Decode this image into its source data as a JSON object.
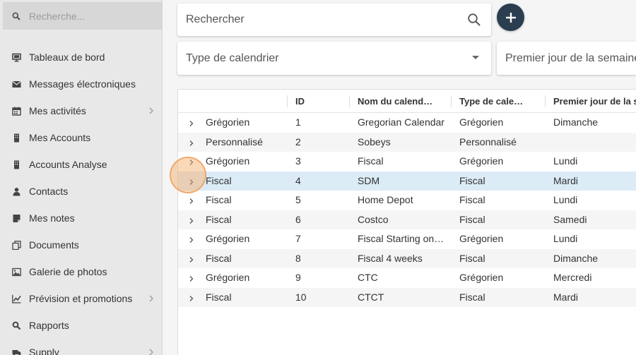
{
  "sidebar": {
    "search_placeholder": "Recherche...",
    "items": [
      {
        "label": "Tableaux de bord",
        "icon": "monitor-icon",
        "chevron": false
      },
      {
        "label": "Messages électroniques",
        "icon": "envelope-icon",
        "chevron": false
      },
      {
        "label": "Mes activités",
        "icon": "calendar-icon",
        "chevron": true
      },
      {
        "label": "Mes Accounts",
        "icon": "building-icon",
        "chevron": false
      },
      {
        "label": "Accounts Analyse",
        "icon": "building-icon",
        "chevron": false
      },
      {
        "label": "Contacts",
        "icon": "user-icon",
        "chevron": false
      },
      {
        "label": "Mes notes",
        "icon": "note-icon",
        "chevron": false
      },
      {
        "label": "Documents",
        "icon": "documents-icon",
        "chevron": false
      },
      {
        "label": "Galerie de photos",
        "icon": "image-icon",
        "chevron": false
      },
      {
        "label": "Prévision et promotions",
        "icon": "line-chart-icon",
        "chevron": true
      },
      {
        "label": "Rapports",
        "icon": "search-report-icon",
        "chevron": false
      },
      {
        "label": "Supply",
        "icon": "truck-icon",
        "chevron": true
      }
    ]
  },
  "toolbar": {
    "search_placeholder": "Rechercher",
    "add_label": "+",
    "filter_type": "Type de calendrier",
    "filter_first_day": "Premier jour de la semaine"
  },
  "grid": {
    "columns": [
      "",
      "ID",
      "Nom du calend…",
      "Type de cale…",
      "Premier jour de la se"
    ],
    "rows": [
      {
        "group": "Grégorien",
        "id": "1",
        "name": "Gregorian Calendar",
        "type": "Grégorien",
        "first_day": "Dimanche"
      },
      {
        "group": "Personnalisé",
        "id": "2",
        "name": "Sobeys",
        "type": "Personnalisé",
        "first_day": ""
      },
      {
        "group": "Grégorien",
        "id": "3",
        "name": "Fiscal",
        "type": "Grégorien",
        "first_day": "Lundi"
      },
      {
        "group": "Fiscal",
        "id": "4",
        "name": "SDM",
        "type": "Fiscal",
        "first_day": "Mardi"
      },
      {
        "group": "Fiscal",
        "id": "5",
        "name": "Home Depot",
        "type": "Fiscal",
        "first_day": "Lundi"
      },
      {
        "group": "Fiscal",
        "id": "6",
        "name": "Costco",
        "type": "Fiscal",
        "first_day": "Samedi"
      },
      {
        "group": "Grégorien",
        "id": "7",
        "name": "Fiscal Starting on …",
        "type": "Grégorien",
        "first_day": "Lundi"
      },
      {
        "group": "Fiscal",
        "id": "8",
        "name": "Fiscal 4 weeks",
        "type": "Fiscal",
        "first_day": "Dimanche"
      },
      {
        "group": "Grégorien",
        "id": "9",
        "name": "CTC",
        "type": "Grégorien",
        "first_day": "Mercredi"
      },
      {
        "group": "Fiscal",
        "id": "10",
        "name": "CTCT",
        "type": "Fiscal",
        "first_day": "Mardi"
      }
    ],
    "selected_row": 3
  },
  "colors": {
    "add_button": "#2b3e50",
    "selected_row": "#dcecf7",
    "sidebar_bg": "#e8e8e8"
  }
}
